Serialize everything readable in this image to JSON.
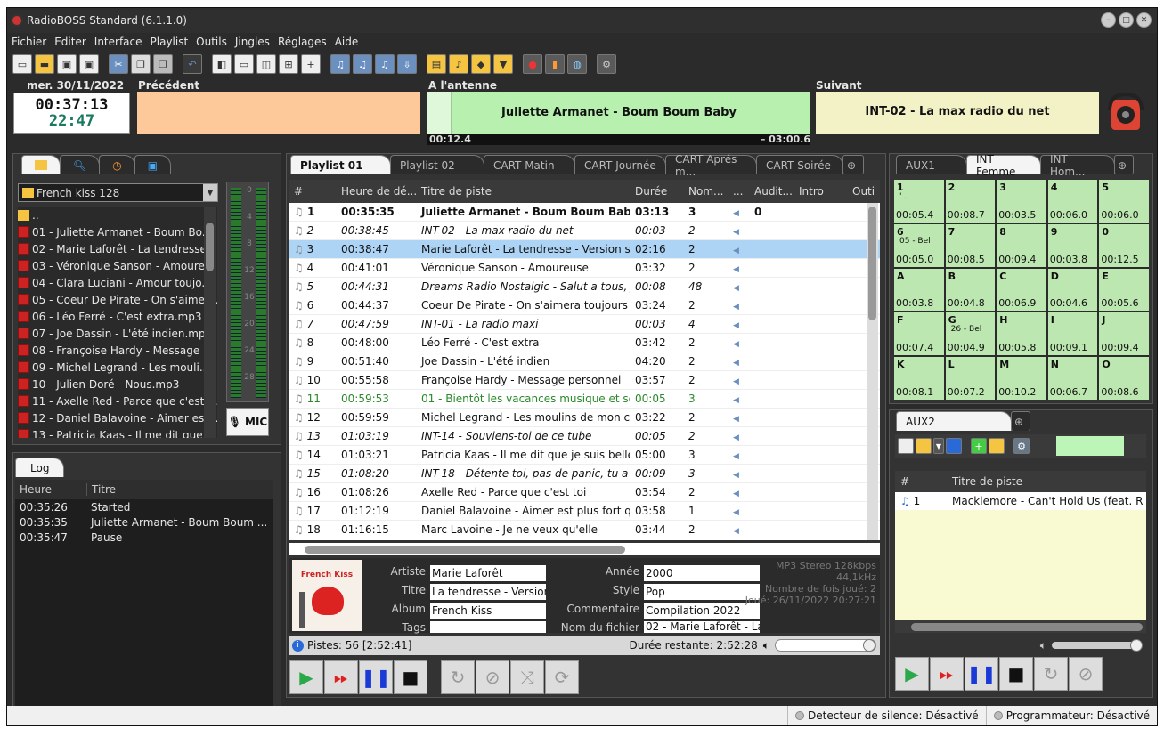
{
  "window": {
    "title": "RadioBOSS Standard (6.1.1.0)"
  },
  "menu": [
    "Fichier",
    "Editer",
    "Interface",
    "Playlist",
    "Outils",
    "Jingles",
    "Réglages",
    "Aide"
  ],
  "header": {
    "date": "mer. 30/11/2022",
    "time": "00:37:13",
    "remaining": "22:47",
    "prev_label": "Précédent",
    "onair_label": "A l'antenne",
    "next_label": "Suivant",
    "onair_title": "Juliette Armanet - Boum Boum Baby",
    "onair_elapsed": "00:12.4",
    "onair_remaining": "– 03:00.6",
    "next_title": "INT-02 - La max radio du net"
  },
  "library": {
    "folder": "French kiss 128",
    "items": [
      "..",
      "01 - Juliette Armanet - Boum Bo...",
      "02 - Marie Laforêt - La tendresse...",
      "03 - Véronique Sanson - Amoure...",
      "04 - Clara Luciani - Amour toujo...",
      "05 - Coeur De Pirate - On s'aimer...",
      "06 - Léo Ferré - C'est extra.mp3",
      "07 - Joe Dassin - L'été indien.mp3",
      "08 - Françoise Hardy - Message ...",
      "09 - Michel Legrand - Les mouli...",
      "10 - Julien Doré - Nous.mp3",
      "11 - Axelle Red - Parce que c'est ...",
      "12 - Daniel Balavoine - Aimer est...",
      "13 - Patricia Kaas - Il me dit que..."
    ],
    "vu_scale": [
      "0",
      "4",
      "8",
      "12",
      "16",
      "20",
      "24",
      "28"
    ],
    "mic_label": "MIC"
  },
  "log": {
    "tab": "Log",
    "col_time": "Heure",
    "col_title": "Titre",
    "rows": [
      {
        "time": "00:35:26",
        "title": "Started"
      },
      {
        "time": "00:35:35",
        "title": "Juliette Armanet - Boum Boum ..."
      },
      {
        "time": "00:35:47",
        "title": "Pause"
      }
    ]
  },
  "playlist": {
    "tabs": [
      "Playlist 01",
      "Playlist 02",
      "CART Matin",
      "CART Journée",
      "CART Aprés m...",
      "CART Soirée"
    ],
    "columns": [
      "#",
      "Heure de dé...",
      "Titre de piste",
      "Durée",
      "Nom...",
      "...",
      "Audit...",
      "Intro",
      "Outi"
    ],
    "rows": [
      {
        "n": "1",
        "time": "00:35:35",
        "title": "Juliette Armanet - Boum Boum Baby",
        "dur": "03:13",
        "plays": "3",
        "aud": "0",
        "style": "bold"
      },
      {
        "n": "2",
        "time": "00:38:45",
        "title": "INT-02 - La max radio du net",
        "dur": "00:03",
        "plays": "2",
        "aud": "",
        "style": "it"
      },
      {
        "n": "3",
        "time": "00:38:47",
        "title": "Marie Laforêt - La tendresse - Version stéréo",
        "dur": "02:16",
        "plays": "2",
        "aud": "",
        "style": "sel"
      },
      {
        "n": "4",
        "time": "00:41:01",
        "title": "Véronique Sanson - Amoureuse",
        "dur": "03:32",
        "plays": "2",
        "aud": "",
        "style": ""
      },
      {
        "n": "5",
        "time": "00:44:31",
        "title": "Dreams Radio Nostalgic - Salut a tous, j'es...",
        "dur": "00:08",
        "plays": "48",
        "aud": "",
        "style": "it"
      },
      {
        "n": "6",
        "time": "00:44:37",
        "title": "Coeur De Pirate - On s'aimera toujours",
        "dur": "03:24",
        "plays": "2",
        "aud": "",
        "style": ""
      },
      {
        "n": "7",
        "time": "00:47:59",
        "title": "INT-01 - La radio maxi",
        "dur": "00:03",
        "plays": "4",
        "aud": "",
        "style": "it"
      },
      {
        "n": "8",
        "time": "00:48:00",
        "title": "Léo Ferré - C'est extra",
        "dur": "03:42",
        "plays": "2",
        "aud": "",
        "style": ""
      },
      {
        "n": "9",
        "time": "00:51:40",
        "title": "Joe Dassin - L'été indien",
        "dur": "04:20",
        "plays": "2",
        "aud": "",
        "style": ""
      },
      {
        "n": "10",
        "time": "00:55:58",
        "title": "Françoise Hardy - Message personnel",
        "dur": "03:57",
        "plays": "2",
        "aud": "",
        "style": ""
      },
      {
        "n": "11",
        "time": "00:59:53",
        "title": "01 - Bientôt les vacances musique et soleil ...",
        "dur": "00:05",
        "plays": "3",
        "aud": "",
        "style": "green"
      },
      {
        "n": "12",
        "time": "00:59:59",
        "title": "Michel Legrand - Les moulins de mon coeur",
        "dur": "03:22",
        "plays": "2",
        "aud": "",
        "style": ""
      },
      {
        "n": "13",
        "time": "01:03:19",
        "title": "INT-14 - Souviens-toi de ce tube",
        "dur": "00:05",
        "plays": "2",
        "aud": "",
        "style": "it"
      },
      {
        "n": "14",
        "time": "01:03:21",
        "title": "Patricia Kaas - Il me dit que je suis belle",
        "dur": "05:00",
        "plays": "3",
        "aud": "",
        "style": ""
      },
      {
        "n": "15",
        "time": "01:08:20",
        "title": "INT-18 - Détente toi, pas de panic, tu a pas...",
        "dur": "00:09",
        "plays": "3",
        "aud": "",
        "style": "it"
      },
      {
        "n": "16",
        "time": "01:08:26",
        "title": "Axelle Red - Parce que c'est toi",
        "dur": "03:54",
        "plays": "2",
        "aud": "",
        "style": ""
      },
      {
        "n": "17",
        "time": "01:12:19",
        "title": "Daniel Balavoine - Aimer est plus fort que ...",
        "dur": "03:58",
        "plays": "1",
        "aud": "",
        "style": ""
      },
      {
        "n": "18",
        "time": "01:16:15",
        "title": "Marc Lavoine - Je ne veux qu'elle",
        "dur": "03:44",
        "plays": "2",
        "aud": "",
        "style": ""
      }
    ]
  },
  "info": {
    "cover_text": "French Kiss",
    "labels": {
      "artist": "Artiste",
      "title": "Titre",
      "album": "Album",
      "tags": "Tags",
      "year": "Année",
      "genre": "Style",
      "comment": "Commentaire",
      "filename": "Nom du fichier"
    },
    "artist": "Marie Laforêt",
    "title": "La tendresse - Version stéréo",
    "album": "French Kiss",
    "tags": "",
    "year": "2000",
    "genre": "Pop",
    "comment": "Compilation 2022",
    "filename": "02 - Marie Laforêt - La tendresse",
    "meta1": "MP3 Stereo 128kbps",
    "meta2": "44,1kHz",
    "meta3": "Nombre de fois joué: 2",
    "meta4": "Joué: 26/11/2022 20:27:21"
  },
  "status": {
    "tracks": "Pistes: 56 [2:52:41]",
    "remaining": "Durée restante: 2:52:28"
  },
  "aux1": {
    "tabs": [
      "AUX1",
      "INT Femme",
      "INT Hom..."
    ],
    "cells": [
      {
        "k": "1",
        "t": "00:05.4",
        "n": "' ."
      },
      {
        "k": "2",
        "t": "00:08.7",
        "n": ""
      },
      {
        "k": "3",
        "t": "00:03.5",
        "n": ""
      },
      {
        "k": "4",
        "t": "00:06.0",
        "n": ""
      },
      {
        "k": "5",
        "t": "00:06.0",
        "n": ""
      },
      {
        "k": "6",
        "t": "00:05.0",
        "n": "05 - Bel"
      },
      {
        "k": "7",
        "t": "00:08.5",
        "n": ""
      },
      {
        "k": "8",
        "t": "00:09.4",
        "n": ""
      },
      {
        "k": "9",
        "t": "00:03.8",
        "n": ""
      },
      {
        "k": "0",
        "t": "00:12.5",
        "n": ""
      },
      {
        "k": "A",
        "t": "00:03.8",
        "n": ""
      },
      {
        "k": "B",
        "t": "00:04.8",
        "n": ""
      },
      {
        "k": "C",
        "t": "00:06.9",
        "n": ""
      },
      {
        "k": "D",
        "t": "00:04.6",
        "n": ""
      },
      {
        "k": "E",
        "t": "00:05.6",
        "n": ""
      },
      {
        "k": "F",
        "t": "00:07.4",
        "n": ""
      },
      {
        "k": "G",
        "t": "00:04.9",
        "n": "26 - Bel"
      },
      {
        "k": "H",
        "t": "00:05.8",
        "n": ""
      },
      {
        "k": "I",
        "t": "00:09.1",
        "n": ""
      },
      {
        "k": "J",
        "t": "00:09.4",
        "n": ""
      },
      {
        "k": "K",
        "t": "00:08.1",
        "n": ""
      },
      {
        "k": "L",
        "t": "00:07.2",
        "n": ""
      },
      {
        "k": "M",
        "t": "00:10.2",
        "n": ""
      },
      {
        "k": "N",
        "t": "00:06.7",
        "n": ""
      },
      {
        "k": "O",
        "t": "00:08.6",
        "n": ""
      }
    ]
  },
  "aux2": {
    "tab": "AUX2",
    "col_n": "#",
    "col_title": "Titre de piste",
    "rows": [
      {
        "n": "1",
        "title": "Macklemore - Can't Hold Us (feat. Ray ..."
      }
    ]
  },
  "statusbar": {
    "silence": "Detecteur de silence: Désactivé",
    "scheduler": "Programmateur: Désactivé"
  },
  "colors": {
    "onair": "#b8f0b0",
    "prev": "#fdc89a",
    "next": "#f3f1c6",
    "selected": "#aed4f5",
    "play": "#2aa84a",
    "fwd": "#e02020",
    "pause": "#1a3ad8"
  }
}
